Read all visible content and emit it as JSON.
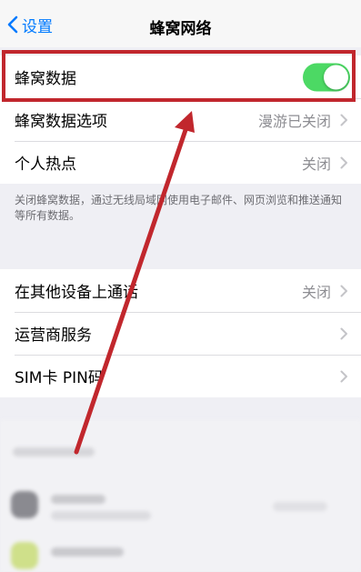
{
  "nav": {
    "back_label": "设置",
    "title": "蜂窝网络"
  },
  "group1": {
    "cellular_data": {
      "label": "蜂窝数据",
      "toggle_on": true
    },
    "cellular_options": {
      "label": "蜂窝数据选项",
      "value": "漫游已关闭"
    },
    "personal_hotspot": {
      "label": "个人热点",
      "value": "关闭"
    }
  },
  "footer_text": "关闭蜂窝数据，通过无线局域网使用电子邮件、网页浏览和推送通知等所有数据。",
  "group2": {
    "calls_other_devices": {
      "label": "在其他设备上通话",
      "value": "关闭"
    },
    "carrier_services": {
      "label": "运营商服务"
    },
    "sim_pin": {
      "label": "SIM卡 PIN码"
    }
  },
  "colors": {
    "accent": "#007aff",
    "toggle_on": "#4cd964",
    "annotation": "#c1272d"
  }
}
